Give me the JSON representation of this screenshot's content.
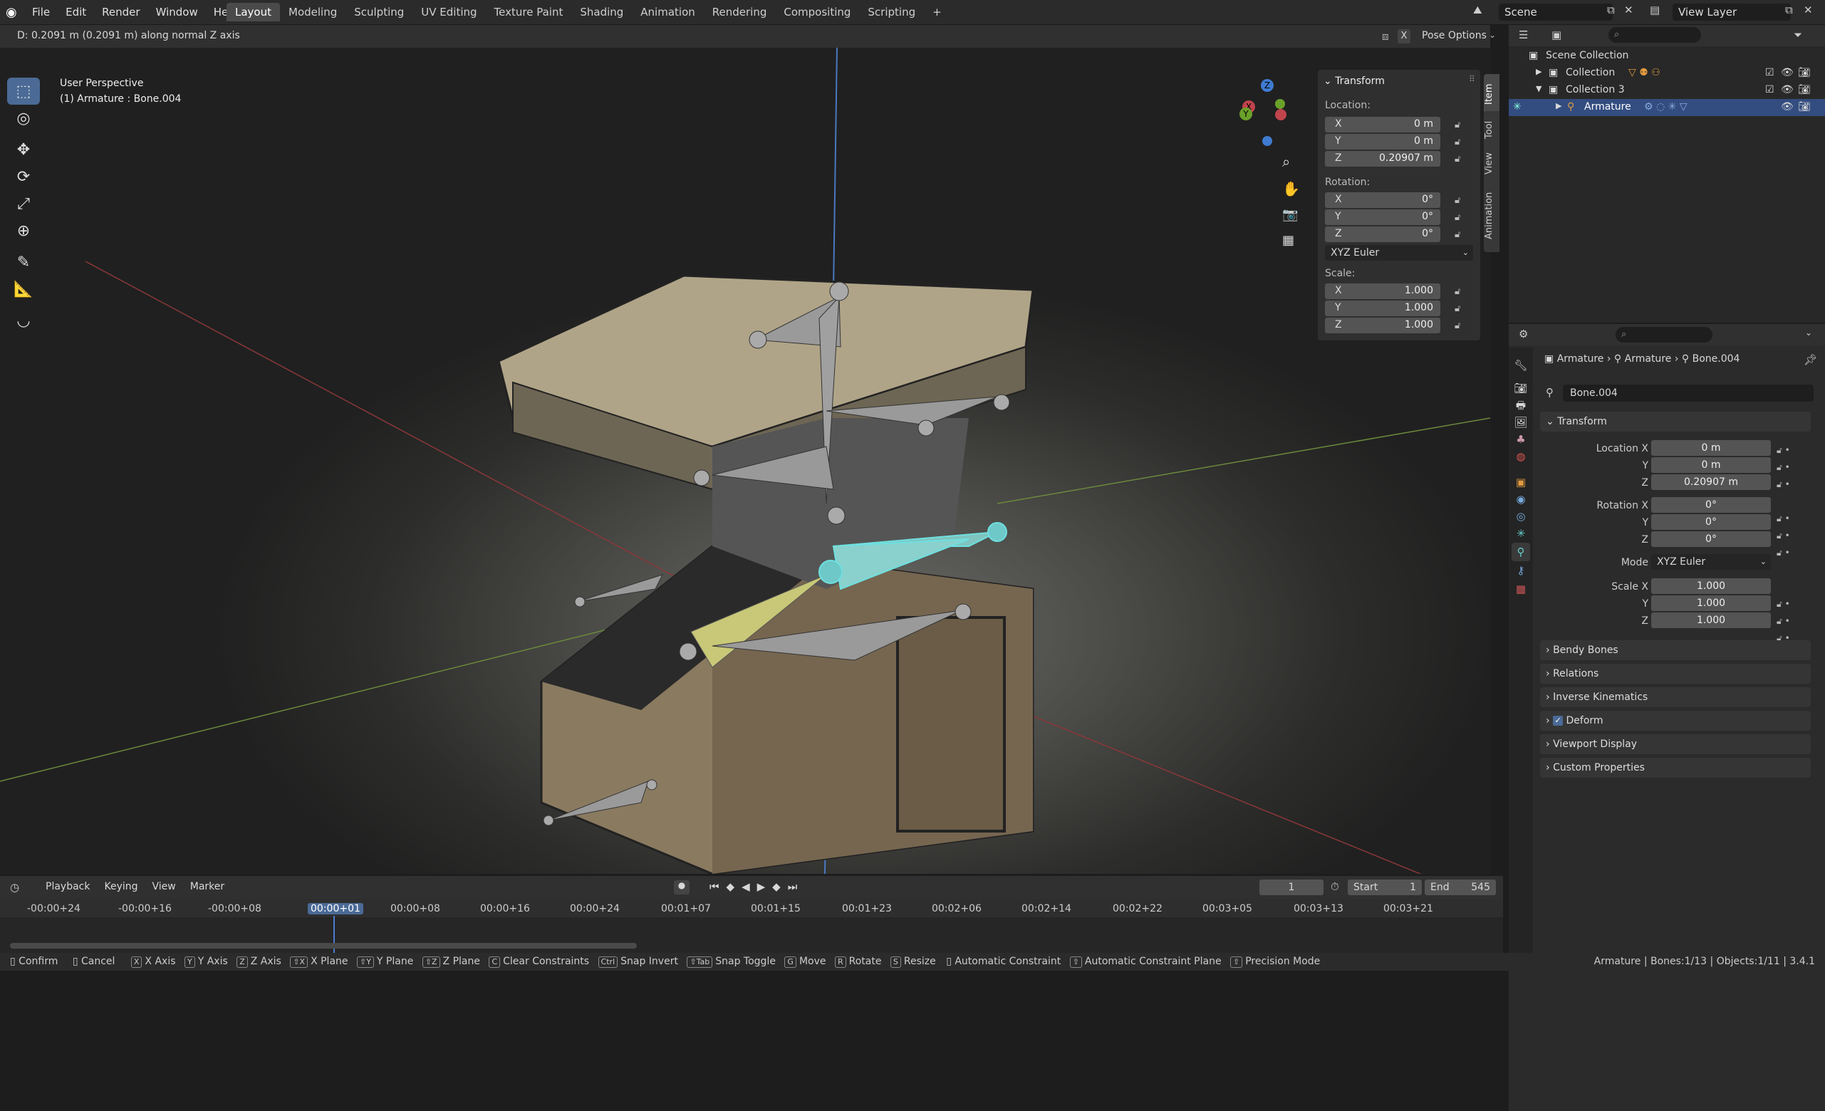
{
  "topbar": {
    "menus": [
      "File",
      "Edit",
      "Render",
      "Window",
      "Help"
    ],
    "workspaces": [
      "Layout",
      "Modeling",
      "Sculpting",
      "UV Editing",
      "Texture Paint",
      "Shading",
      "Animation",
      "Rendering",
      "Compositing",
      "Scripting"
    ],
    "active_workspace": "Layout",
    "add_label": "+",
    "scene": "Scene",
    "view_layer": "View Layer"
  },
  "viewport": {
    "status_text": "D: 0.2091 m (0.2091 m) along normal Z axis",
    "perspective": "User Perspective",
    "object_info": "(1) Armature : Bone.004",
    "pose_options": "Pose Options",
    "x_label": "X",
    "gizmo": {
      "x": "X",
      "y": "Y",
      "z": "Z"
    }
  },
  "npanel": {
    "title": "Transform",
    "location_label": "Location:",
    "location": [
      {
        "axis": "X",
        "value": "0 m"
      },
      {
        "axis": "Y",
        "value": "0 m"
      },
      {
        "axis": "Z",
        "value": "0.20907 m"
      }
    ],
    "rotation_label": "Rotation:",
    "rotation": [
      {
        "axis": "X",
        "value": "0°"
      },
      {
        "axis": "Y",
        "value": "0°"
      },
      {
        "axis": "Z",
        "value": "0°"
      }
    ],
    "rotation_mode": "XYZ Euler",
    "scale_label": "Scale:",
    "scale": [
      {
        "axis": "X",
        "value": "1.000"
      },
      {
        "axis": "Y",
        "value": "1.000"
      },
      {
        "axis": "Z",
        "value": "1.000"
      }
    ],
    "tabs": [
      "Item",
      "Tool",
      "View",
      "Animation"
    ]
  },
  "outliner": {
    "scene_collection": "Scene Collection",
    "items": [
      "Collection",
      "Collection 3",
      "Armature"
    ]
  },
  "properties": {
    "breadcrumb": [
      "Armature",
      "Armature",
      "Bone.004"
    ],
    "bone_name": "Bone.004",
    "transform_title": "Transform",
    "location_x_label": "Location X",
    "y_label": "Y",
    "z_label": "Z",
    "location": [
      "0 m",
      "0 m",
      "0.20907 m"
    ],
    "rotation_x_label": "Rotation X",
    "rotation": [
      "0°",
      "0°",
      "0°"
    ],
    "mode_label": "Mode",
    "mode_value": "XYZ Euler",
    "scale_x_label": "Scale X",
    "scale": [
      "1.000",
      "1.000",
      "1.000"
    ],
    "panels": [
      "Bendy Bones",
      "Relations",
      "Inverse Kinematics",
      "Deform",
      "Viewport Display",
      "Custom Properties"
    ]
  },
  "timeline": {
    "menus": [
      "Playback",
      "Keying",
      "View",
      "Marker"
    ],
    "current_frame": "1",
    "start_label": "Start",
    "start": "1",
    "end_label": "End",
    "end": "545",
    "ticks": [
      "-00:00+24",
      "-00:00+16",
      "-00:00+08",
      "00:00+01",
      "00:00+08",
      "00:00+16",
      "00:00+24",
      "00:01+07",
      "00:01+15",
      "00:01+23",
      "00:02+06",
      "00:02+14",
      "00:02+22",
      "00:03+05",
      "00:03+13",
      "00:03+21"
    ]
  },
  "statusbar": {
    "items": [
      {
        "key": "",
        "label": "Confirm"
      },
      {
        "key": "",
        "label": "Cancel"
      },
      {
        "key": "X",
        "label": "X Axis"
      },
      {
        "key": "Y",
        "label": "Y Axis"
      },
      {
        "key": "Z",
        "label": "Z Axis"
      },
      {
        "key": "⇧X",
        "label": "X Plane"
      },
      {
        "key": "⇧Y",
        "label": "Y Plane"
      },
      {
        "key": "⇧Z",
        "label": "Z Plane"
      },
      {
        "key": "C",
        "label": "Clear Constraints"
      },
      {
        "key": "Ctrl",
        "label": "Snap Invert"
      },
      {
        "key": "⇧Tab",
        "label": "Snap Toggle"
      },
      {
        "key": "G",
        "label": "Move"
      },
      {
        "key": "R",
        "label": "Rotate"
      },
      {
        "key": "S",
        "label": "Resize"
      },
      {
        "key": "",
        "label": "Automatic Constraint"
      },
      {
        "key": "⇧",
        "label": "Automatic Constraint Plane"
      },
      {
        "key": "⇧",
        "label": "Precision Mode"
      }
    ],
    "info": "Armature | Bones:1/13 | Objects:1/11 | 3.4.1"
  }
}
